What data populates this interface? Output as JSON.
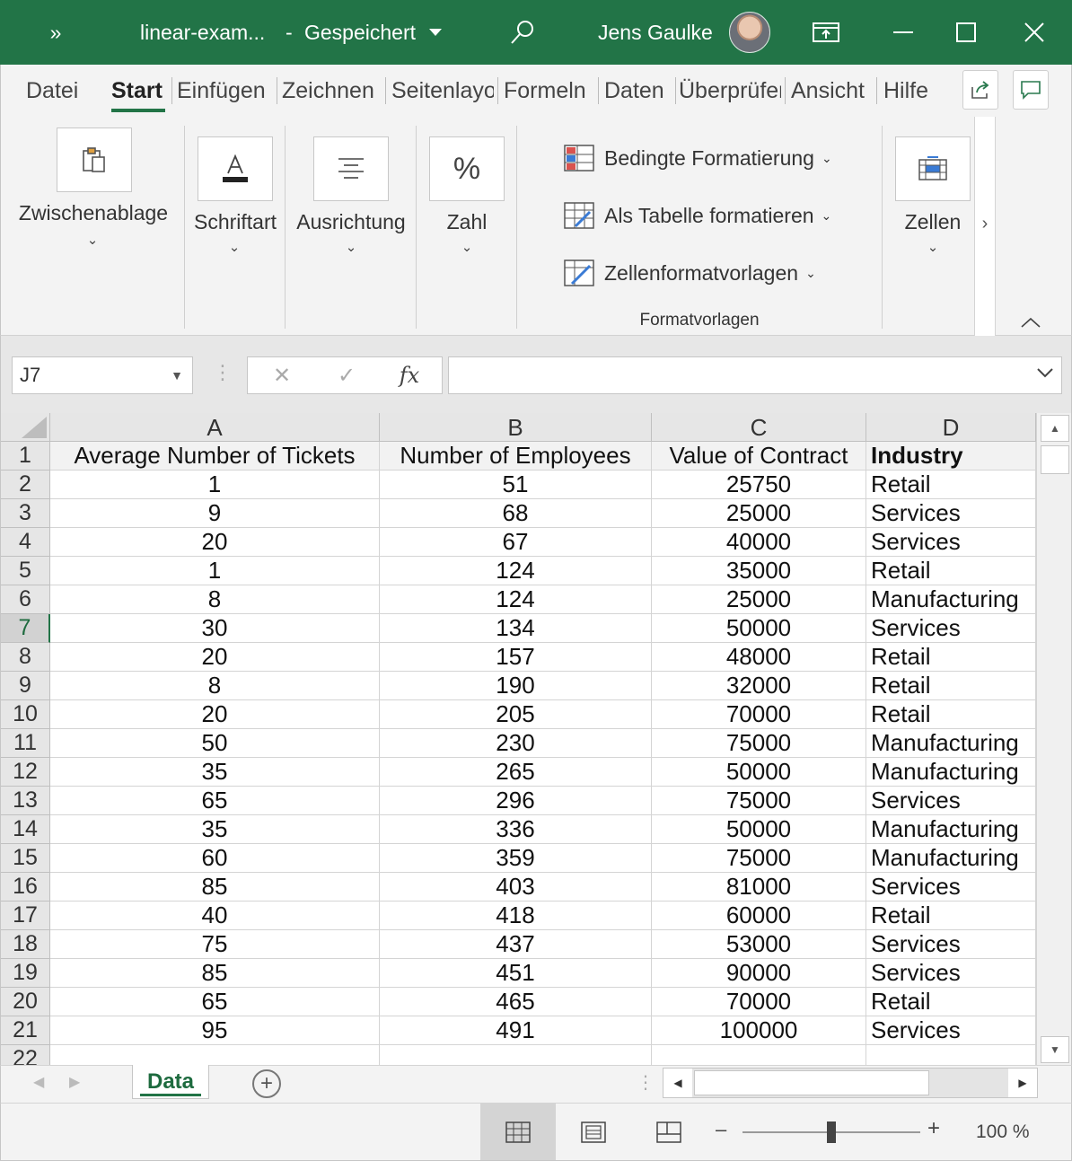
{
  "titlebar": {
    "qat_symbol": "»",
    "doc_title": "linear-exam...",
    "separator": "-",
    "save_status": "Gespeichert",
    "user_name": "Jens Gaulke",
    "color": "#227447"
  },
  "ribbon_tabs": [
    {
      "label": "Datei"
    },
    {
      "label": "Start"
    },
    {
      "label": "Einfügen"
    },
    {
      "label": "Zeichnen"
    },
    {
      "label": "Seitenlayout"
    },
    {
      "label": "Formeln"
    },
    {
      "label": "Daten"
    },
    {
      "label": "Überprüfen"
    },
    {
      "label": "Ansicht"
    },
    {
      "label": "Hilfe"
    }
  ],
  "ribbon": {
    "clipboard_label": "Zwischenablage",
    "font_label": "Schriftart",
    "font_icon_letter": "A",
    "alignment_label": "Ausrichtung",
    "number_label": "Zahl",
    "number_icon": "%",
    "cond_format": "Bedingte Formatierung",
    "as_table": "Als Tabelle formatieren",
    "cell_styles": "Zellenformatvorlagen",
    "styles_group": "Formatvorlagen",
    "cells_label": "Zellen",
    "scroll_right": "›"
  },
  "formula_bar": {
    "name_box": "J7",
    "cancel_icon": "✕",
    "enter_icon": "✓",
    "fx_label": "fx",
    "formula": ""
  },
  "sheet": {
    "columns": [
      "A",
      "B",
      "C",
      "D"
    ],
    "header_row": [
      "Average Number of Tickets",
      "Number of Employees",
      "Value of Contract",
      "Industry"
    ],
    "row_numbers": [
      "1",
      "2",
      "3",
      "4",
      "5",
      "6",
      "7",
      "8",
      "9",
      "10",
      "11",
      "12",
      "13",
      "14",
      "15",
      "16",
      "17",
      "18",
      "19",
      "20",
      "21",
      "22"
    ],
    "active_row": "7",
    "rows": [
      [
        "1",
        "51",
        "25750",
        "Retail"
      ],
      [
        "9",
        "68",
        "25000",
        "Services"
      ],
      [
        "20",
        "67",
        "40000",
        "Services"
      ],
      [
        "1",
        "124",
        "35000",
        "Retail"
      ],
      [
        "8",
        "124",
        "25000",
        "Manufacturing"
      ],
      [
        "30",
        "134",
        "50000",
        "Services"
      ],
      [
        "20",
        "157",
        "48000",
        "Retail"
      ],
      [
        "8",
        "190",
        "32000",
        "Retail"
      ],
      [
        "20",
        "205",
        "70000",
        "Retail"
      ],
      [
        "50",
        "230",
        "75000",
        "Manufacturing"
      ],
      [
        "35",
        "265",
        "50000",
        "Manufacturing"
      ],
      [
        "65",
        "296",
        "75000",
        "Services"
      ],
      [
        "35",
        "336",
        "50000",
        "Manufacturing"
      ],
      [
        "60",
        "359",
        "75000",
        "Manufacturing"
      ],
      [
        "85",
        "403",
        "81000",
        "Services"
      ],
      [
        "40",
        "418",
        "60000",
        "Retail"
      ],
      [
        "75",
        "437",
        "53000",
        "Services"
      ],
      [
        "85",
        "451",
        "90000",
        "Services"
      ],
      [
        "65",
        "465",
        "70000",
        "Retail"
      ],
      [
        "95",
        "491",
        "100000",
        "Services"
      ]
    ]
  },
  "sheet_tabs": {
    "active": "Data",
    "add_symbol": "+"
  },
  "statusbar": {
    "zoom_minus": "–",
    "zoom_plus": "+",
    "zoom_level": "100 %",
    "zoom_fraction": 0.5
  }
}
